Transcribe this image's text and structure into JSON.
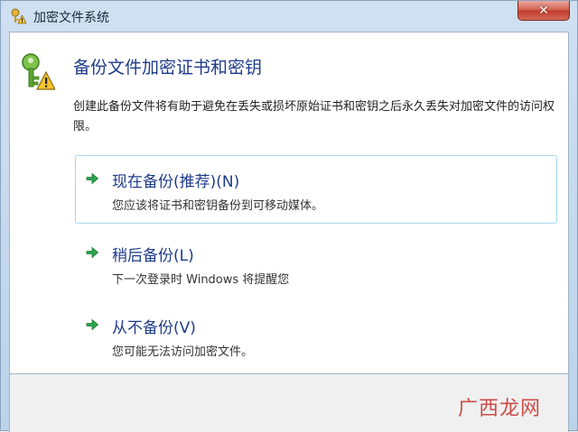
{
  "window": {
    "title": "加密文件系统"
  },
  "header": {
    "heading": "备份文件加密证书和密钥",
    "description": "创建此备份文件将有助于避免在丢失或损坏原始证书和密钥之后永久丢失对加密文件的访问权限。"
  },
  "options": [
    {
      "title": "现在备份(推荐)(N)",
      "subtitle": "您应该将证书和密钥备份到可移动媒体。"
    },
    {
      "title": "稍后备份(L)",
      "subtitle": "下一次登录时 Windows 将提醒您"
    },
    {
      "title": "从不备份(V)",
      "subtitle": "您可能无法访问加密文件。"
    }
  ],
  "watermark": "广西龙网",
  "icons": {
    "app": "key-warning-icon",
    "header": "key-warning-icon",
    "option_arrow": "green-arrow-icon",
    "close": "close-icon"
  },
  "colors": {
    "heading": "#1e3b8a",
    "arrow": "#2ea44f",
    "close_button": "#c0392b",
    "hover_border": "#a6d8ee"
  }
}
